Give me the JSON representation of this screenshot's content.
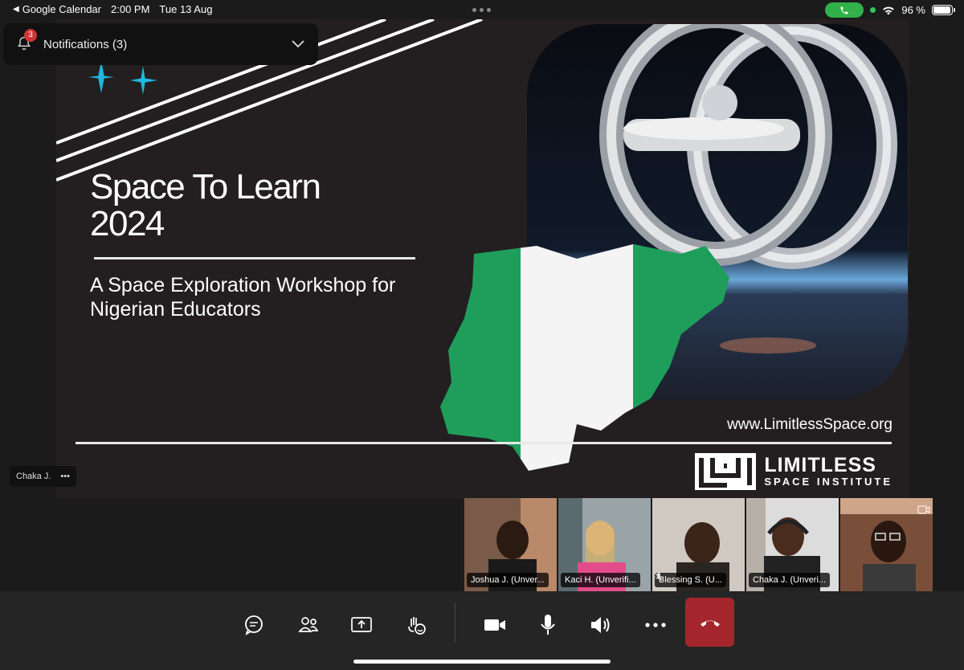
{
  "status_bar": {
    "back_app": "Google Calendar",
    "time": "2:00 PM",
    "date": "Tue 13 Aug",
    "battery": "96 %",
    "battery_level": 0.96
  },
  "notifications": {
    "label": "Notifications (3)",
    "badge": "3"
  },
  "slide": {
    "title_line1": "Space To Learn",
    "title_line2": "2024",
    "subtitle_line1": "A Space Exploration Workshop for",
    "subtitle_line2": "Nigerian Educators",
    "url": "www.LimitlessSpace.org",
    "logo_name": "LIMITLESS",
    "logo_sub": "SPACE INSTITUTE"
  },
  "presenter": {
    "name": "Chaka J.",
    "more": "•••"
  },
  "participants": [
    {
      "name": "Joshua J. (Unver...",
      "muted": false
    },
    {
      "name": "Kaci H. (Unverifi...",
      "muted": false
    },
    {
      "name": "Blessing S. (U...",
      "muted": true
    },
    {
      "name": "Chaka J. (Unveri...",
      "muted": false
    },
    {
      "name": "",
      "muted": false
    }
  ],
  "toolbar": {
    "icons": [
      "chat-icon",
      "people-icon",
      "share-screen-icon",
      "raise-hand-icon",
      "camera-icon",
      "microphone-icon",
      "speaker-icon",
      "more-icon",
      "hang-up-icon"
    ]
  },
  "colors": {
    "hangup": "#a4262c",
    "call_pill": "#30b14a",
    "badge": "#d13438",
    "flag_green": "#1e9e5a"
  }
}
